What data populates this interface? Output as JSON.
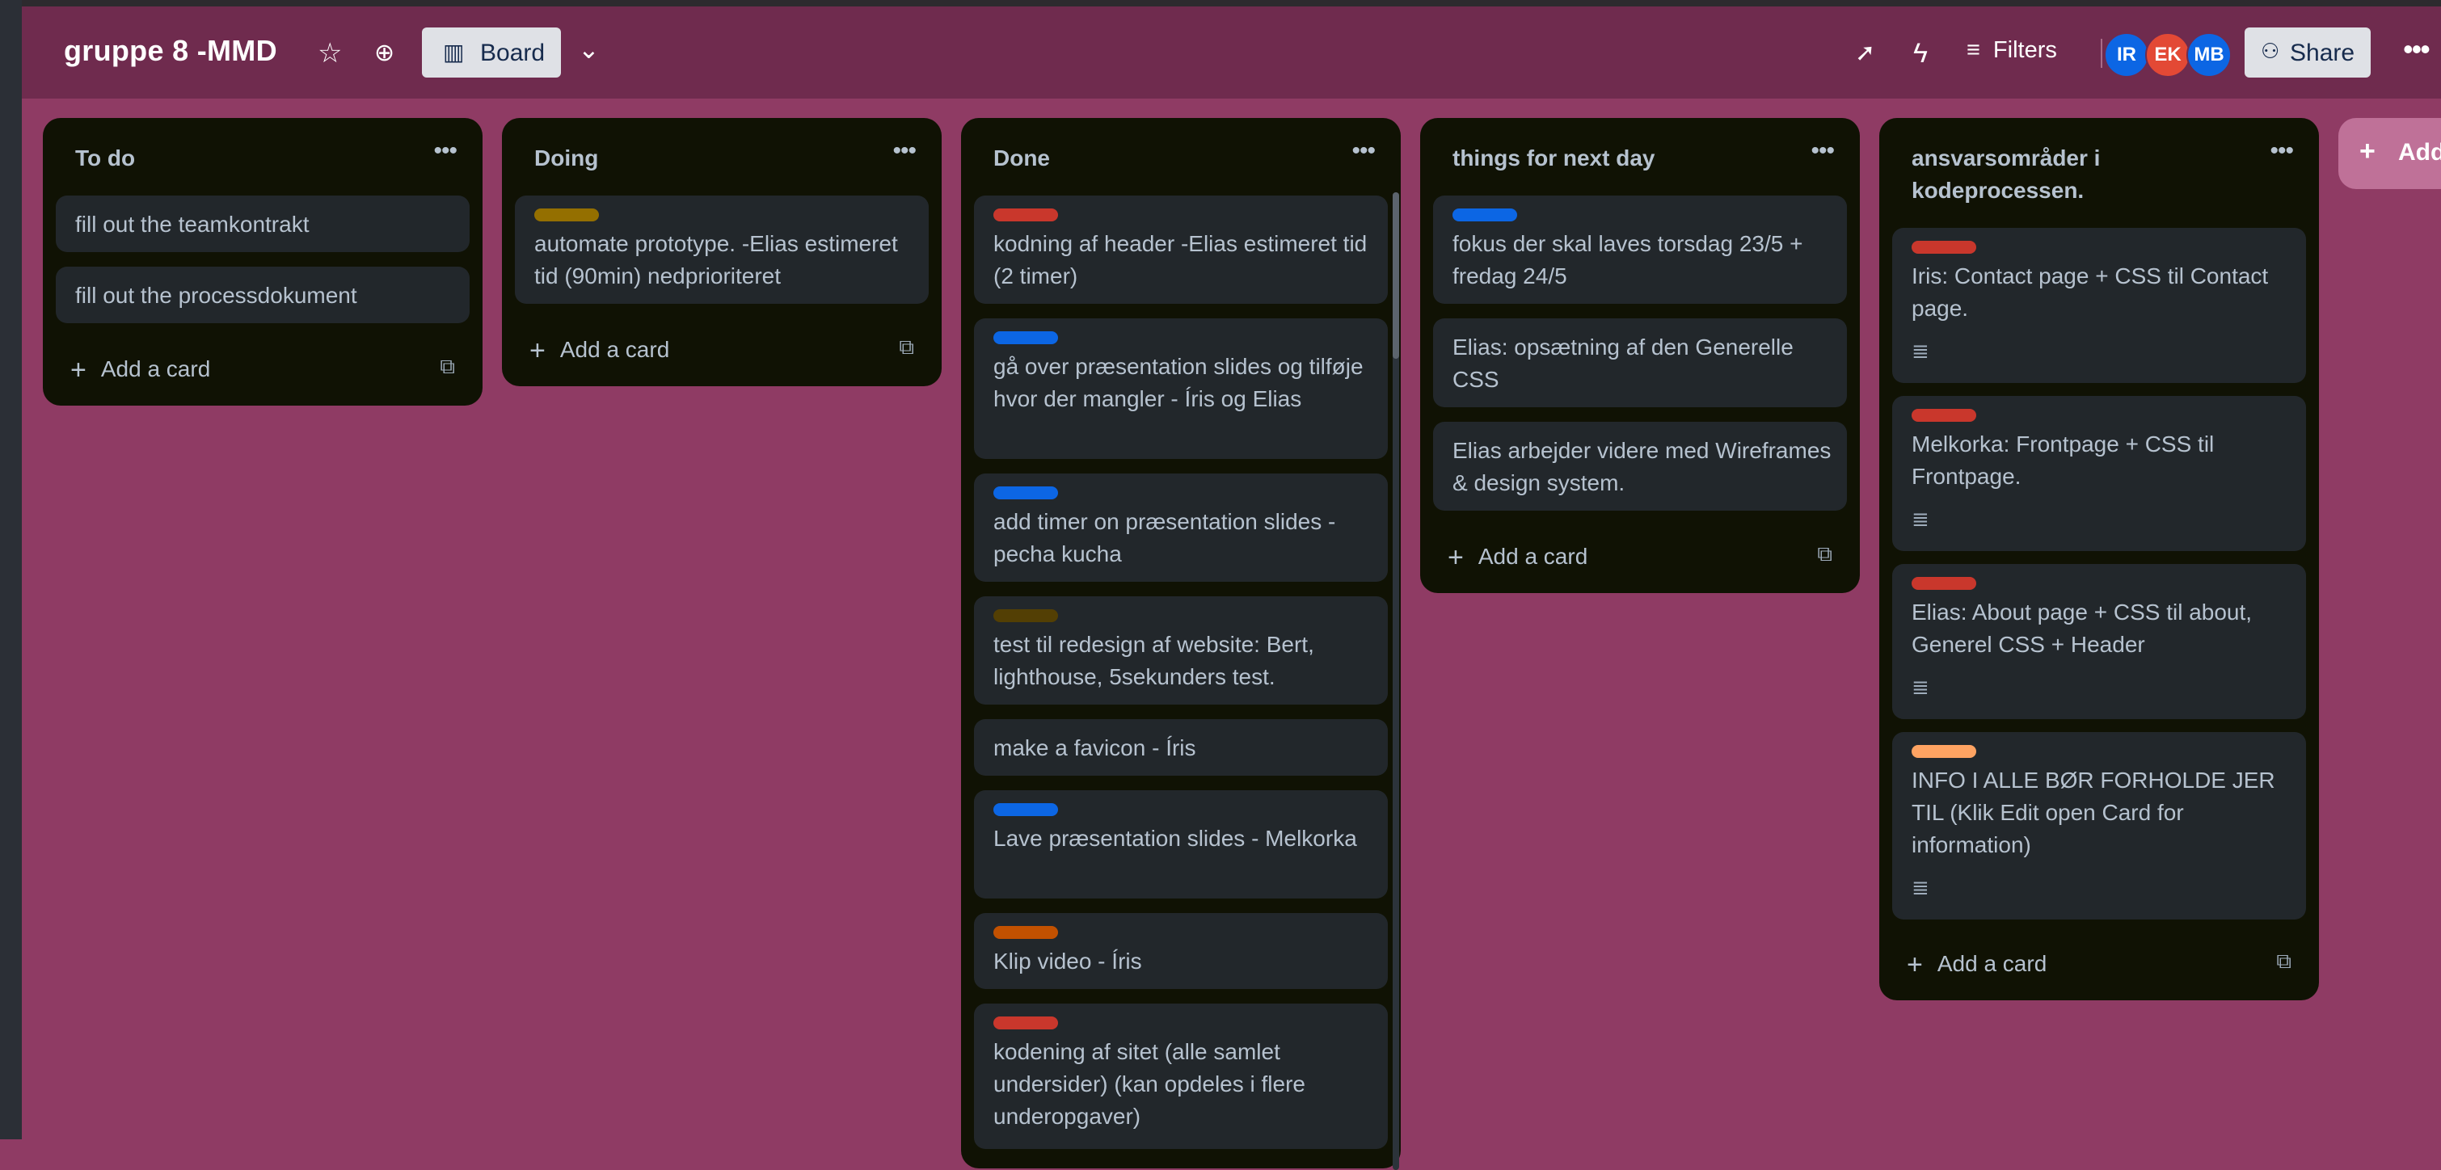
{
  "header": {
    "board_title": "gruppe 8 -MMD",
    "view_button": "Board",
    "filters_label": "Filters",
    "share_label": "Share",
    "avatars": [
      {
        "initials": "IR",
        "color": "#0c66e4"
      },
      {
        "initials": "EK",
        "color": "#e34935"
      },
      {
        "initials": "MB",
        "color": "#0c66e4"
      }
    ]
  },
  "lists": [
    {
      "title": "To do",
      "add_card": "Add a card",
      "cards": [
        {
          "text": "fill out the teamkontrakt"
        },
        {
          "text": "fill out the processdokument"
        }
      ]
    },
    {
      "title": "Doing",
      "add_card": "Add a card",
      "cards": [
        {
          "text": "automate prototype. -Elias estimeret tid (90min) nedprioriteret",
          "label": "#946f00"
        }
      ]
    },
    {
      "title": "Done",
      "cards": [
        {
          "text": "kodning af header -Elias estimeret tid (2 timer)",
          "label": "#c9372c"
        },
        {
          "text": "gå over præsentation slides og tilføje hvor der mangler - Íris og Elias",
          "label": "#0c66e4"
        },
        {
          "text": "add timer on præsentation slides - pecha kucha",
          "label": "#0c66e4"
        },
        {
          "text": "test til redesign af website: Bert, lighthouse, 5sekunders test.",
          "label": "#533f04"
        },
        {
          "text": "make a favicon - Íris"
        },
        {
          "text": "Lave præsentation slides - Melkorka",
          "label": "#0c66e4"
        },
        {
          "text": "Klip video - Íris",
          "label": "#c25100"
        },
        {
          "text": "kodening af sitet (alle samlet undersider) (kan opdeles i flere underopgaver)",
          "label": "#c9372c"
        }
      ]
    },
    {
      "title": "things for next day",
      "add_card": "Add a card",
      "cards": [
        {
          "text": "fokus der skal laves torsdag 23/5 + fredag 24/5",
          "label": "#0c66e4"
        },
        {
          "text": "Elias: opsætning af den Generelle CSS"
        },
        {
          "text": "Elias arbejder videre med Wireframes & design system."
        }
      ]
    },
    {
      "title": "ansvarsområder i kodeprocessen.",
      "add_card": "Add a card",
      "cards": [
        {
          "text": "Iris: Contact page + CSS til Contact page.",
          "label": "#c9372c"
        },
        {
          "text": "Melkorka: Frontpage + CSS til Frontpage.",
          "label": "#c9372c"
        },
        {
          "text": "Elias: About page + CSS til about, Generel CSS + Header",
          "label": "#c9372c"
        },
        {
          "text": "INFO I ALLE BØR FORHOLDE JER TIL (Klik Edit open Card for information)",
          "label": "#fea362"
        }
      ]
    }
  ],
  "add_list_label": "Add"
}
